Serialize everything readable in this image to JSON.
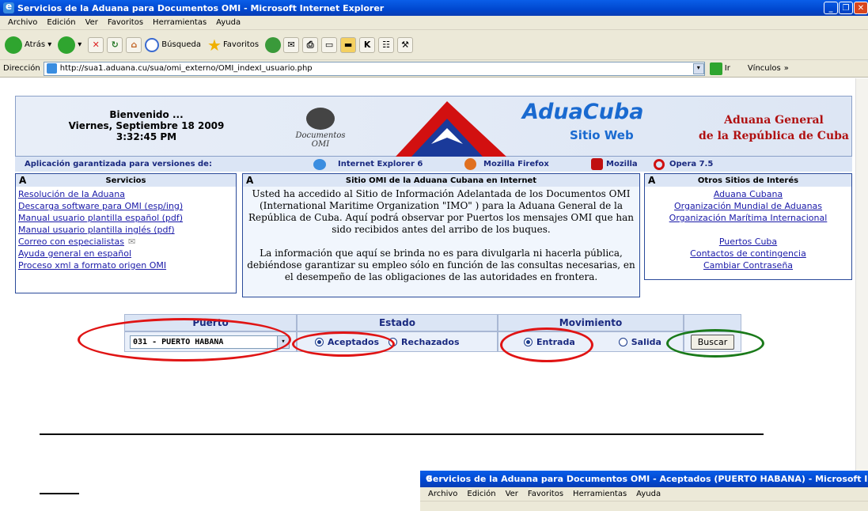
{
  "window": {
    "title": "Servicios de la Aduana para Documentos OMI - Microsoft Internet Explorer",
    "second_title": "Servicios de la Aduana para Documentos OMI - Aceptados (PUERTO HABANA) - Microsoft Inter"
  },
  "menu": [
    "Archivo",
    "Edición",
    "Ver",
    "Favoritos",
    "Herramientas",
    "Ayuda"
  ],
  "toolbar": {
    "back": "Atrás",
    "search": "Búsqueda",
    "favorites": "Favoritos"
  },
  "address": {
    "label": "Dirección",
    "url": "http://sua1.aduana.cu/sua/omi_externo/OMI_indexI_usuario.php",
    "go": "Ir",
    "links": "Vínculos"
  },
  "banner": {
    "welcome": "Bienvenido ...",
    "date": "Viernes, Septiembre 18 2009",
    "time": "3:32:45 PM",
    "omi_caption": "Documentos OMI",
    "brand": "AduaCuba",
    "brand_sub": "Sitio Web",
    "agency_line1": "Aduana General",
    "agency_line2": "de la República de Cuba"
  },
  "browsers": {
    "caption": "Aplicación garantizada para versiones de:",
    "items": [
      "Internet Explorer 6",
      "Mozilla Firefox",
      "Mozilla",
      "Opera 7.5"
    ]
  },
  "services": {
    "title": "Servicios",
    "links": [
      "Resolución de la Aduana",
      "Descarga software para OMI (esp/ing)",
      "Manual usuario plantilla español (pdf)",
      "Manual usuario plantilla inglés (pdf)",
      "Correo con especialistas",
      "Ayuda general en español",
      "Proceso xml a formato origen OMI"
    ]
  },
  "center": {
    "title": "Sitio OMI  de la Aduana Cubana en Internet",
    "para1": "Usted ha accedido al Sitio de Información Adelantada de los Documentos OMI (International Maritime Organization \"IMO\" )  para la Aduana General de la República de Cuba.  Aquí podrá observar por Puertos los mensajes OMI que han sido recibidos antes del arribo de los buques.",
    "para2": "La información que aquí se brinda no es para divulgarla ni hacerla pública, debiéndose garantizar su empleo sólo en función de las consultas necesarias, en el desempeño de las obligaciones de las autoridades en frontera."
  },
  "others": {
    "title": "Otros Sitios de Interés",
    "links": [
      "Aduana Cubana",
      "Organización Mundial de Aduanas",
      "Organización Marítima Internacional",
      "Puertos Cuba",
      "Contactos de contingencia",
      "Cambiar Contraseña"
    ]
  },
  "form": {
    "puerto_label": "Puerto",
    "estado_label": "Estado",
    "movimiento_label": "Movimiento",
    "puerto_value": "031 - PUERTO HABANA",
    "aceptados": "Aceptados",
    "rechazados": "Rechazados",
    "entrada": "Entrada",
    "salida": "Salida",
    "buscar": "Buscar"
  },
  "colors": {
    "highlight_red": "#e01414",
    "highlight_green": "#1a7a1a"
  }
}
